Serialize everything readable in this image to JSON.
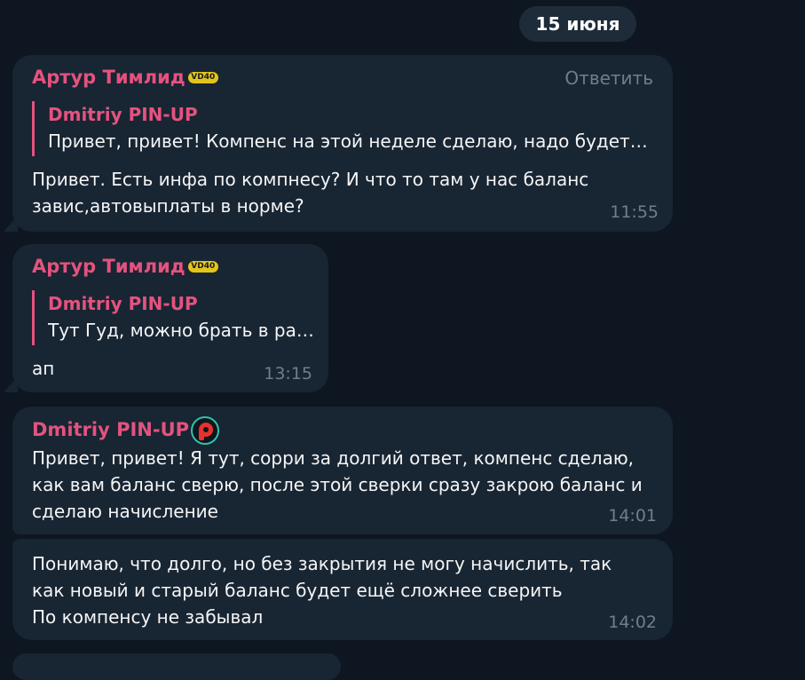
{
  "date_separator": "15 июня",
  "badge_label": "VD40",
  "messages": [
    {
      "sender": "Артур Тимлид",
      "reply_action": "Ответить",
      "quote_name": "Dmitriy PIN-UP",
      "quote_text": "Привет, привет! Компенс на этой неделе сделаю, надо будет …",
      "lines": [
        "Привет. Есть инфа по компнесу? И что то там у нас баланс",
        "завис,автовыплаты в норме?"
      ],
      "time": "11:55"
    },
    {
      "sender": "Артур Тимлид",
      "quote_name": "Dmitriy PIN-UP",
      "quote_text": "Тут Гуд, можно брать в ра…",
      "lines": [
        "ап"
      ],
      "time": "13:15"
    },
    {
      "sender": "Dmitriy PIN-UP",
      "lines": [
        "Привет, привет! Я тут, сорри за долгий ответ, компенс сделаю,",
        "как вам баланс сверю, после этой сверки сразу закрою баланс и",
        "сделаю начисление"
      ],
      "time": "14:01"
    },
    {
      "lines": [
        "Понимаю, что долго, но без закрытия не могу начислить, так",
        "как новый и старый баланс будет ещё сложнее сверить",
        "По компенсу не забывал"
      ],
      "time": "14:02"
    }
  ],
  "colors": {
    "background": "#0e1621",
    "bubble": "#182533",
    "sender_name": "#e5527e",
    "meta": "#6d7f8f"
  }
}
